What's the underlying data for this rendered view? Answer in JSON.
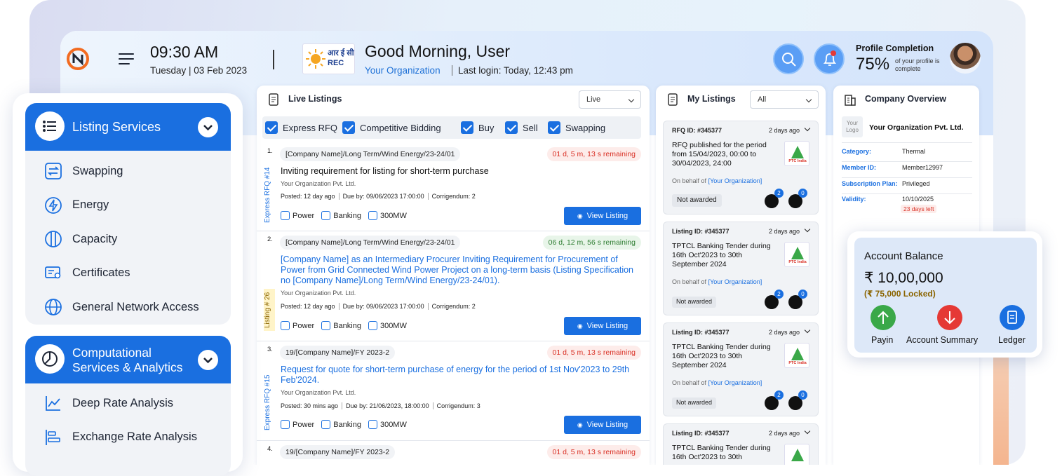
{
  "header": {
    "time": "09:30 AM",
    "date": "Tuesday | 03 Feb 2023",
    "org_logo_text": "आर ई सी REC",
    "greeting": "Good Morning, User",
    "org_name": "Your Organization",
    "last_login": "Last login: Today, 12:43 pm",
    "profile_title": "Profile Completion",
    "profile_percent": "75%",
    "profile_sub": "of your profile is complete"
  },
  "sidebar": {
    "group1": {
      "title": "Listing Services",
      "items": [
        {
          "label": "Swapping",
          "icon": "swap-icon"
        },
        {
          "label": "Energy",
          "icon": "energy-icon"
        },
        {
          "label": "Capacity",
          "icon": "capacity-icon"
        },
        {
          "label": "Certificates",
          "icon": "certificate-icon"
        },
        {
          "label": "General Network Access",
          "icon": "globe-icon"
        }
      ]
    },
    "group2": {
      "title_line1": "Computational",
      "title_line2": "Services & Analytics",
      "items": [
        {
          "label": "Deep Rate Analysis",
          "icon": "chart-line-icon"
        },
        {
          "label": "Exchange Rate Analysis",
          "icon": "bar-list-icon"
        }
      ]
    }
  },
  "live": {
    "title": "Live Listings",
    "select_value": "Live",
    "filters": [
      "Express RFQ",
      "Competitive Bidding",
      "Buy",
      "Sell",
      "Swapping"
    ],
    "listings": [
      {
        "num": "1.",
        "tag": "[Company Name]/Long Term/Wind Energy/23-24/01",
        "remaining": "01 d, 5 m, 13 s remaining",
        "side": "Express RFQ #14",
        "title": "Inviting requirement for listing for short-term purchase",
        "org": "Your Organization Pvt. Ltd.",
        "posted": "Posted: 12 day ago",
        "due": "Due by: 09/06/2023 17:00:00",
        "corr": "Corrigendum: 2",
        "t1": "Power",
        "t2": "Banking",
        "t3": "300MW",
        "btn": "View Listing"
      },
      {
        "num": "2.",
        "tag": "[Company Name]/Long Term/Wind Energy/23-24/01",
        "remaining": "06 d, 12 m, 56 s remaining",
        "side": "Listing # 26",
        "title": "[Company Name] as an Intermediary Procurer Inviting Requirement for Procurement of Power from Grid Connected Wind Power Project on a long-term basis (Listing Specification no [Company Name]/Long Term/Wind Energy/23-24/01).",
        "org": "Your Organization Pvt. Ltd.",
        "posted": "Posted: 12 day ago",
        "due": "Due by: 09/06/2023 17:00:00",
        "corr": "Corrigendum: 2",
        "t1": "Power",
        "t2": "Banking",
        "t3": "300MW",
        "btn": "View Listing"
      },
      {
        "num": "3.",
        "tag": "19/[Company Name]/FY 2023-2",
        "remaining": "01 d, 5 m, 13 s remaining",
        "side": "Express RFQ #15",
        "title": "Request for quote for short-term purchase of energy for the period of 1st Nov'2023 to 29th Feb'2024.",
        "org": "Your Organization Pvt. Ltd.",
        "posted": "Posted: 30 mins ago",
        "due": "Due by: 21/06/2023, 18:00:00",
        "corr": "Corrigendum: 3",
        "t1": "Power",
        "t2": "Banking",
        "t3": "300MW",
        "btn": "View Listing"
      },
      {
        "num": "4.",
        "tag": "19/[Company Name]/FY 2023-2",
        "remaining": "01 d, 5 m, 13 s remaining"
      }
    ]
  },
  "my": {
    "title": "My Listings",
    "select_value": "All",
    "cards": [
      {
        "id": "RFQ ID: #345377",
        "ago": "2 days ago",
        "text": "RFQ published for the period from 15/04/2023, 00:00 to 30/04/2023, 24:00",
        "behalf": "On behalf of",
        "behalf_org": "[Your Organization]",
        "status": "Not awarded",
        "badge1": "2",
        "badge2": "0",
        "logo": "PTC India"
      },
      {
        "id": "Listing ID: #345377",
        "ago": "2 days ago",
        "text": "TPTCL Banking Tender during 16th Oct'2023 to 30th September 2024",
        "behalf": "On behalf of",
        "behalf_org": "[Your Organization]",
        "status": "Not awarded",
        "badge1": "2",
        "badge2": "0",
        "logo": "PTC India"
      },
      {
        "id": "Listing ID: #345377",
        "ago": "2 days ago",
        "text": "TPTCL Banking Tender during 16th Oct'2023 to 30th September 2024",
        "behalf": "On behalf of",
        "behalf_org": "[Your Organization]",
        "status": "Not awarded",
        "badge1": "2",
        "badge2": "0",
        "logo": "PTC India"
      },
      {
        "id": "Listing ID: #345377",
        "ago": "2 days ago",
        "text": "TPTCL Banking Tender during 16th Oct'2023 to 30th"
      }
    ]
  },
  "company": {
    "title": "Company Overview",
    "logo_text": "Your Logo",
    "name": "Your Organization Pvt. Ltd.",
    "rows": [
      {
        "k": "Category:",
        "v": "Thermal"
      },
      {
        "k": "Member ID:",
        "v": "Member12997"
      },
      {
        "k": "Subscription Plan:",
        "v": "Privileged"
      },
      {
        "k": "Validity:",
        "v": "10/10/2025"
      }
    ],
    "days_left": "23 days left"
  },
  "balance": {
    "title": "Account Balance",
    "amount": "₹ 10,00,000",
    "locked": "(₹ 75,000 Locked)",
    "payin": "Payin",
    "summary": "Account Summary",
    "ledger": "Ledger",
    "colors": {
      "payin": "#3aa848",
      "summary": "#e53935",
      "ledger": "#1a6fe0"
    }
  }
}
